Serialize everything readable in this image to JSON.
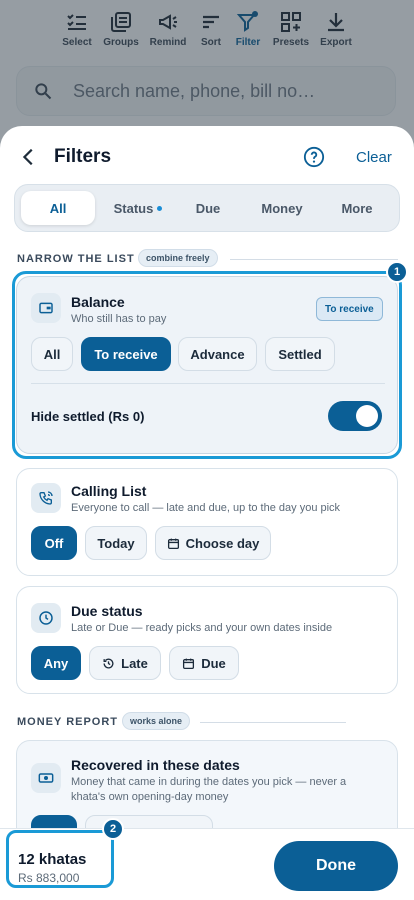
{
  "toolbar": {
    "items": [
      {
        "label": "Select",
        "icon": "checklist-icon"
      },
      {
        "label": "Groups",
        "icon": "stack-icon"
      },
      {
        "label": "Remind",
        "icon": "megaphone-icon"
      },
      {
        "label": "Sort",
        "icon": "sort-icon"
      },
      {
        "label": "Filter",
        "icon": "filter-icon"
      },
      {
        "label": "Presets",
        "icon": "grid-plus-icon"
      },
      {
        "label": "Export",
        "icon": "download-icon"
      }
    ]
  },
  "search": {
    "placeholder": "Search name, phone, bill no…"
  },
  "sheet": {
    "title": "Filters",
    "clear_label": "Clear",
    "tabs": [
      {
        "label": "All",
        "active": true
      },
      {
        "label": "Status",
        "dot": true
      },
      {
        "label": "Due"
      },
      {
        "label": "Money"
      },
      {
        "label": "More"
      }
    ],
    "narrow_section": {
      "label": "NARROW THE LIST",
      "tag": "combine freely"
    },
    "balance": {
      "title": "Balance",
      "subtitle": "Who still has to pay",
      "badge": "To receive",
      "options": [
        "All",
        "To receive",
        "Advance",
        "Settled"
      ],
      "selected": "To receive",
      "toggle_label": "Hide settled (Rs 0)",
      "toggle_on": true
    },
    "calling": {
      "title": "Calling List",
      "subtitle": "Everyone to call — late and due, up to the day you pick",
      "options": [
        "Off",
        "Today",
        "Choose day"
      ],
      "selected": "Off"
    },
    "due_status": {
      "title": "Due status",
      "subtitle": "Late or Due — ready picks and your own dates inside",
      "options": [
        "Any",
        "Late",
        "Due"
      ],
      "selected": "Any"
    },
    "report_section": {
      "label": "MONEY REPORT",
      "tag": "works alone"
    },
    "recovered": {
      "title": "Recovered in these dates",
      "subtitle_line1": "Money that came in during the dates you pick — never a",
      "subtitle_line2": "khata's own opening-day money"
    }
  },
  "footer": {
    "count": "12 khatas",
    "amount": "Rs 883,000",
    "done_label": "Done"
  },
  "callouts": [
    "1",
    "2"
  ],
  "colors": {
    "accent": "#0b5f96",
    "focus": "#1a9ad6"
  }
}
